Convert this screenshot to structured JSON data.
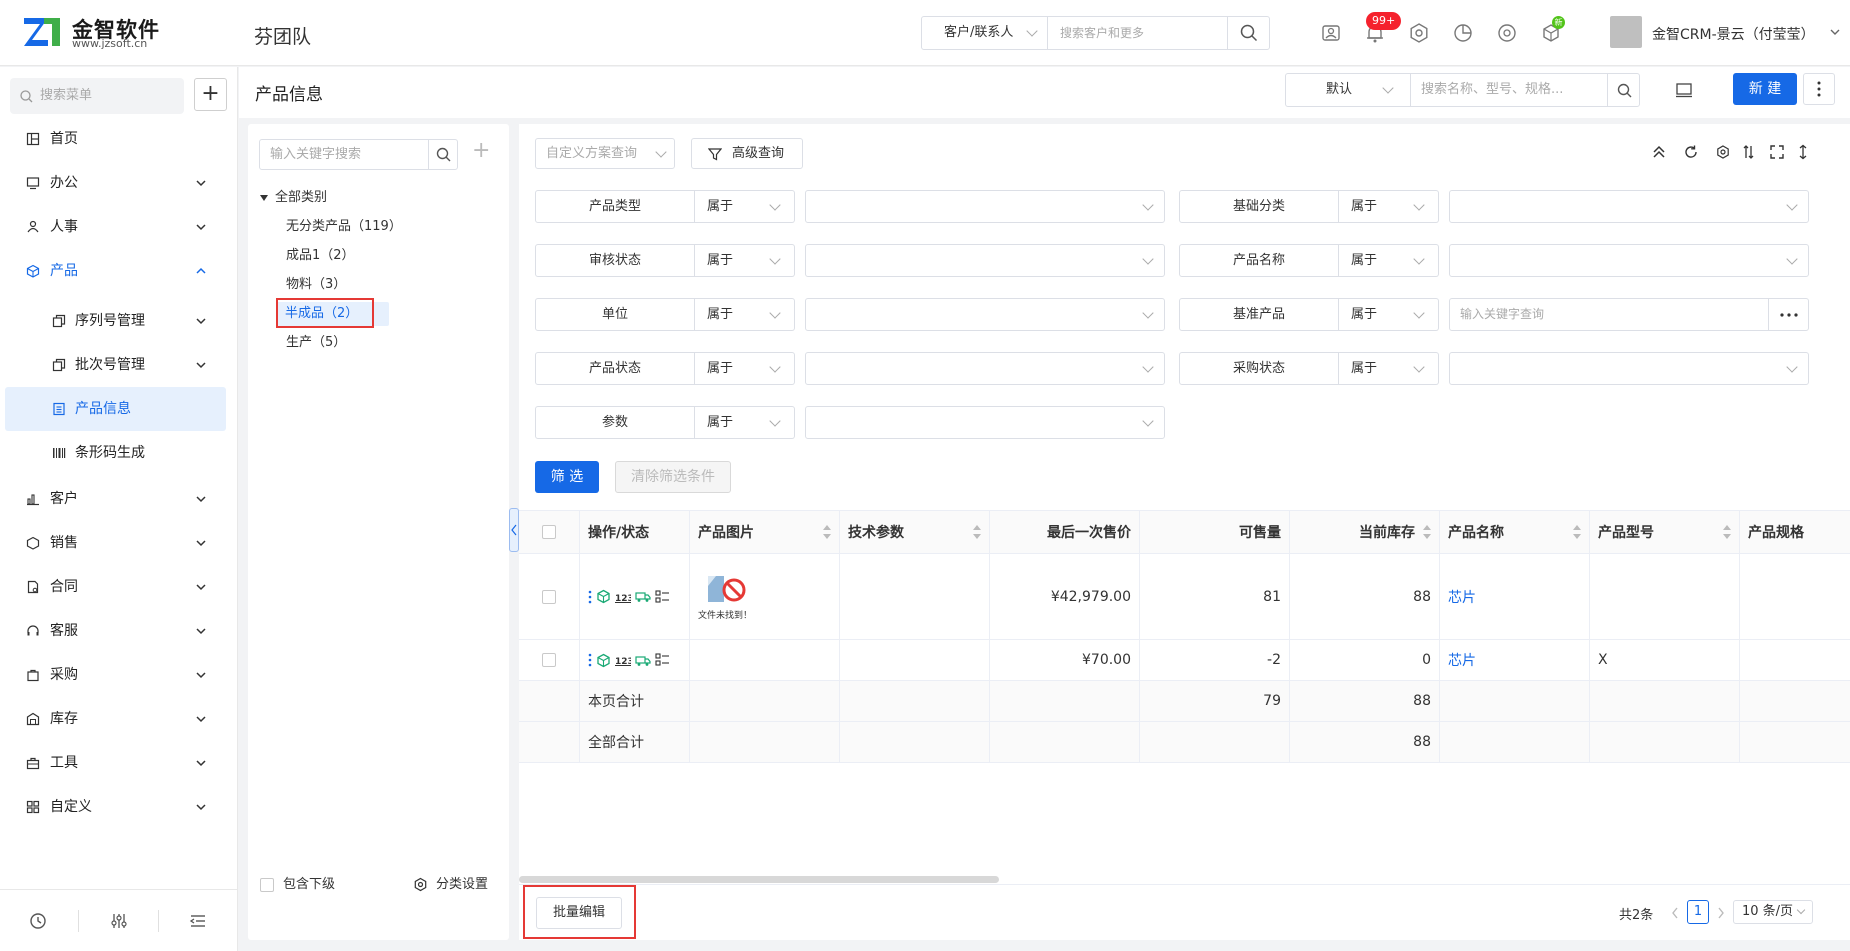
{
  "header": {
    "logo_name": "金智软件",
    "logo_url": "www.jzsoft.cn",
    "team": "芬团队",
    "search_scope": "客户/联系人",
    "search_placeholder": "搜索客户和更多",
    "notif_badge": "99+",
    "new_badge": "新",
    "user_name": "金智CRM-景云（付莹莹）"
  },
  "sidebar": {
    "search_placeholder": "搜索菜单",
    "add_label": "+",
    "items": [
      {
        "label": "首页",
        "icon": "home-icon"
      },
      {
        "label": "办公",
        "icon": "office-icon"
      },
      {
        "label": "人事",
        "icon": "people-icon"
      },
      {
        "label": "产品",
        "icon": "box-icon"
      },
      {
        "label": "序列号管理",
        "icon": "copy-icon"
      },
      {
        "label": "批次号管理",
        "icon": "copy-icon"
      },
      {
        "label": "产品信息",
        "icon": "list-icon"
      },
      {
        "label": "条形码生成",
        "icon": "barcode-icon"
      },
      {
        "label": "客户",
        "icon": "chart-icon"
      },
      {
        "label": "销售",
        "icon": "cube-icon"
      },
      {
        "label": "合同",
        "icon": "contract-icon"
      },
      {
        "label": "客服",
        "icon": "headset-icon"
      },
      {
        "label": "采购",
        "icon": "bag-icon"
      },
      {
        "label": "库存",
        "icon": "warehouse-icon"
      },
      {
        "label": "工具",
        "icon": "toolbox-icon"
      },
      {
        "label": "自定义",
        "icon": "grid-icon"
      }
    ]
  },
  "titlebar": {
    "title": "产品信息",
    "view_select": "默认",
    "search_placeholder": "搜索名称、型号、规格...",
    "new_label": "新 建"
  },
  "tree": {
    "search_placeholder": "输入关键字搜索",
    "root": "全部类别",
    "nodes": [
      "无分类产品（119）",
      "成品1（2）",
      "物料（3）",
      "半成品（2）",
      "生产（5）"
    ],
    "include_sub": "包含下级",
    "settings": "分类设置"
  },
  "filters": {
    "custom_scheme": "自定义方案查询",
    "advanced": "高级查询",
    "fields": [
      {
        "label": "产品类型",
        "op": "属于",
        "placeholder": ""
      },
      {
        "label": "基础分类",
        "op": "属于",
        "placeholder": ""
      },
      {
        "label": "审核状态",
        "op": "属于",
        "placeholder": ""
      },
      {
        "label": "产品名称",
        "op": "属于",
        "placeholder": ""
      },
      {
        "label": "单位",
        "op": "属于",
        "placeholder": ""
      },
      {
        "label": "基准产品",
        "op": "属于",
        "placeholder": "输入关键字查询"
      },
      {
        "label": "产品状态",
        "op": "属于",
        "placeholder": ""
      },
      {
        "label": "采购状态",
        "op": "属于",
        "placeholder": ""
      },
      {
        "label": "参数",
        "op": "属于",
        "placeholder": ""
      }
    ],
    "filter_btn": "筛 选",
    "clear_btn": "清除筛选条件"
  },
  "table": {
    "columns": [
      "操作/状态",
      "产品图片",
      "技术参数",
      "最后一次售价",
      "可售量",
      "当前库存",
      "产品名称",
      "产品型号",
      "产品规格"
    ],
    "rows": [
      {
        "price": "¥42,979.00",
        "sellable": "81",
        "stock": "88",
        "name": "芯片",
        "model": "",
        "image_caption": "文件未找到！"
      },
      {
        "price": "¥70.00",
        "sellable": "-2",
        "stock": "0",
        "name": "芯片",
        "model": "X",
        "image_caption": ""
      }
    ],
    "page_total_label": "本页合计",
    "page_total_sellable": "79",
    "page_total_stock": "88",
    "all_total_label": "全部合计",
    "all_total_stock": "88"
  },
  "footer": {
    "bulk_edit": "批量编辑",
    "total": "共2条",
    "page": "1",
    "page_size": "10 条/页"
  }
}
